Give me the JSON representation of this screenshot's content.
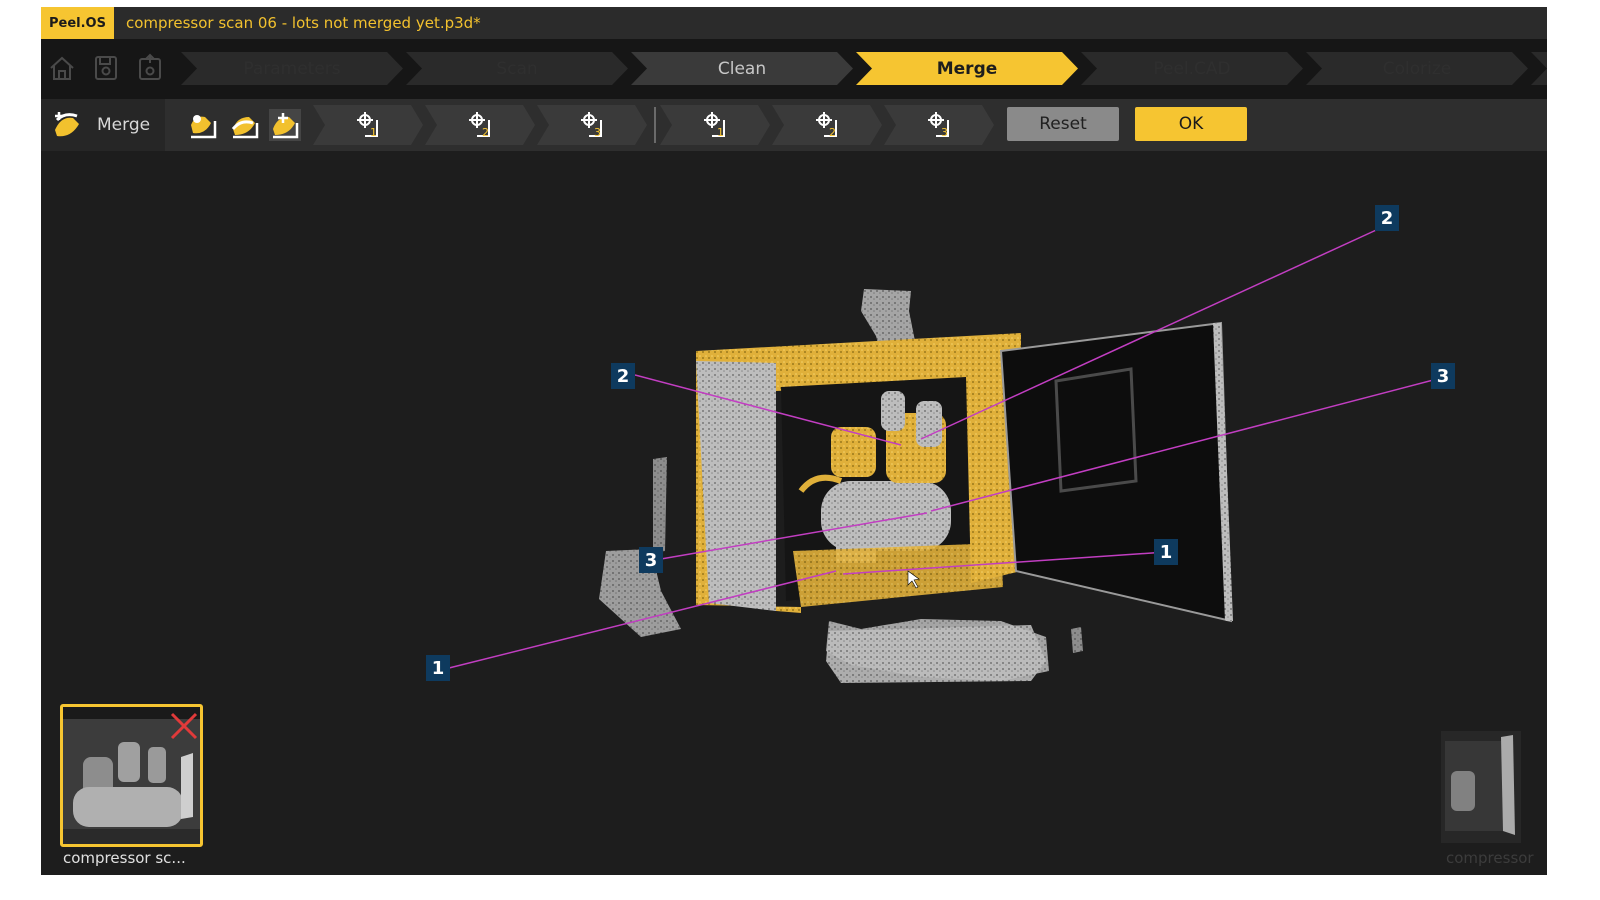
{
  "app": {
    "logo": "Peel.OS",
    "title": "compressor scan 06 - lots not merged yet.p3d*"
  },
  "nav_icons": [
    "home-icon",
    "save-icon",
    "save-as-icon"
  ],
  "steps": [
    {
      "label": "Parameters",
      "state": "inactive"
    },
    {
      "label": "Scan",
      "state": "inactive"
    },
    {
      "label": "Clean",
      "state": "done"
    },
    {
      "label": "Merge",
      "state": "active"
    },
    {
      "label": "Peel.CAD",
      "state": "inactive"
    },
    {
      "label": "Colorize",
      "state": "inactive"
    }
  ],
  "toolbar": {
    "tool_label": "Merge",
    "tool_icon": "merge-tool-icon",
    "mode_icons": [
      "scan-a-icon",
      "scan-b-icon",
      "point-pair-mode-icon"
    ],
    "first_points": [
      "1",
      "2",
      "3"
    ],
    "second_points": [
      "1",
      "2",
      "3"
    ],
    "reset_label": "Reset",
    "ok_label": "OK"
  },
  "markers": [
    "1",
    "2",
    "3",
    "1",
    "2",
    "3"
  ],
  "thumbnails": [
    {
      "label": "compressor sc...",
      "selected": true,
      "remove_icon": "close-x-icon"
    },
    {
      "label": "compressor",
      "selected": false
    }
  ],
  "colors": {
    "accent": "#f6c531",
    "marker_bg": "#0e3a5e",
    "link_line": "#c23ec2",
    "background": "#1d1d1d"
  }
}
